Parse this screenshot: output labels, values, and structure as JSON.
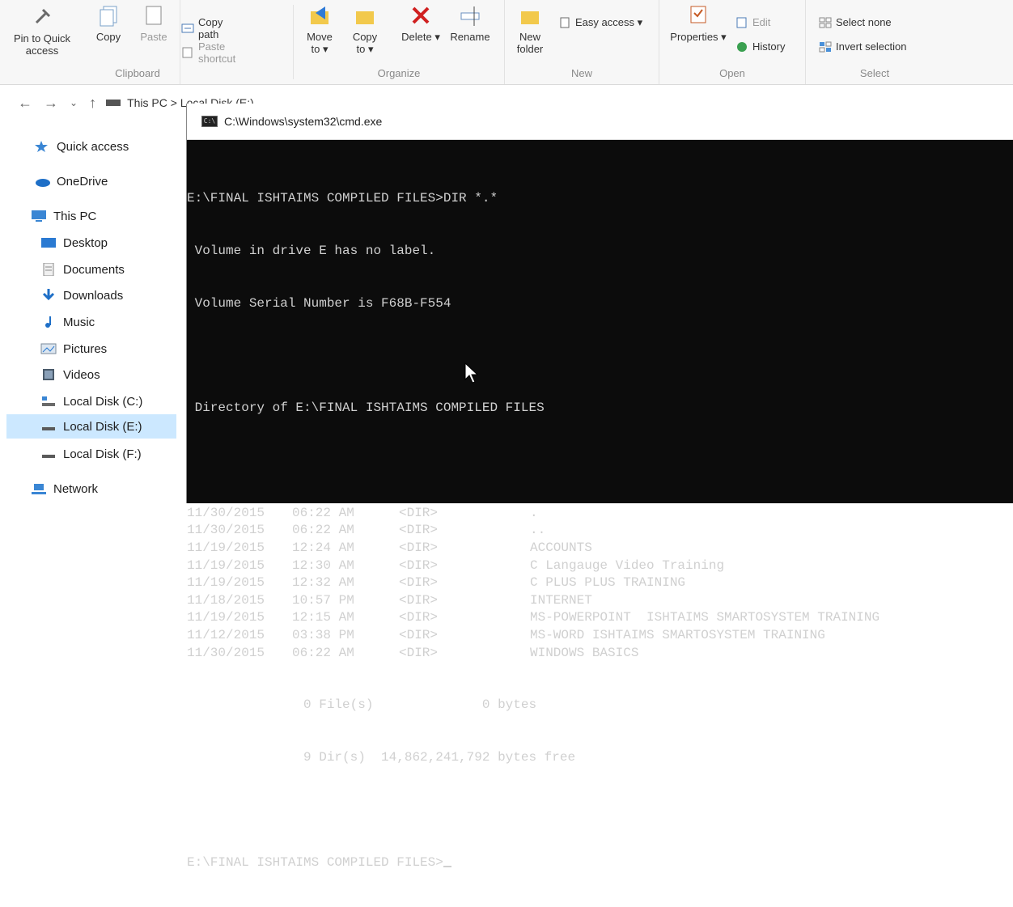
{
  "ribbon": {
    "clipboard": {
      "pin_label": "Pin to Quick access",
      "copy_label": "Copy",
      "paste_label": "Paste",
      "copy_path_label": "Copy path",
      "paste_shortcut_label": "Paste shortcut",
      "group_label": "Clipboard"
    },
    "organize": {
      "move_to_label": "Move to ▾",
      "copy_to_label": "Copy to ▾",
      "delete_label": "Delete ▾",
      "rename_label": "Rename",
      "group_label": "Organize"
    },
    "new": {
      "new_folder_label": "New folder",
      "easy_access_label": "Easy access ▾",
      "group_label": "New"
    },
    "open": {
      "properties_label": "Properties ▾",
      "edit_label": "Edit",
      "history_label": "History",
      "group_label": "Open"
    },
    "select": {
      "select_none_label": "Select none",
      "invert_selection_label": "Invert selection",
      "group_label": "Select"
    }
  },
  "address_bar": {
    "path": "This PC  >  Local Disk (E:)"
  },
  "nav_pane": {
    "items": [
      {
        "label": "Quick access"
      },
      {
        "label": "OneDrive"
      },
      {
        "label": "This PC"
      },
      {
        "label": "Desktop"
      },
      {
        "label": "Documents"
      },
      {
        "label": "Downloads"
      },
      {
        "label": "Music"
      },
      {
        "label": "Pictures"
      },
      {
        "label": "Videos"
      },
      {
        "label": "Local Disk (C:)"
      },
      {
        "label": "Local Disk (E:)"
      },
      {
        "label": "Local Disk (F:)"
      },
      {
        "label": "Network"
      }
    ]
  },
  "cmd": {
    "title": "C:\\Windows\\system32\\cmd.exe",
    "command_line": "E:\\FINAL ISHTAIMS COMPILED FILES>DIR *.*",
    "volume_label_line": " Volume in drive E has no label.",
    "serial_line": " Volume Serial Number is F68B-F554",
    "directory_line": " Directory of E:\\FINAL ISHTAIMS COMPILED FILES",
    "entries": [
      {
        "date": "11/30/2015",
        "time": "06:22 AM",
        "type": "<DIR>",
        "name": "."
      },
      {
        "date": "11/30/2015",
        "time": "06:22 AM",
        "type": "<DIR>",
        "name": ".."
      },
      {
        "date": "11/19/2015",
        "time": "12:24 AM",
        "type": "<DIR>",
        "name": "ACCOUNTS"
      },
      {
        "date": "11/19/2015",
        "time": "12:30 AM",
        "type": "<DIR>",
        "name": "C Langauge Video Training"
      },
      {
        "date": "11/19/2015",
        "time": "12:32 AM",
        "type": "<DIR>",
        "name": "C PLUS PLUS TRAINING"
      },
      {
        "date": "11/18/2015",
        "time": "10:57 PM",
        "type": "<DIR>",
        "name": "INTERNET"
      },
      {
        "date": "11/19/2015",
        "time": "12:15 AM",
        "type": "<DIR>",
        "name": "MS-POWERPOINT  ISHTAIMS SMARTOSYSTEM TRAINING"
      },
      {
        "date": "11/12/2015",
        "time": "03:38 PM",
        "type": "<DIR>",
        "name": "MS-WORD ISHTAIMS SMARTOSYSTEM TRAINING"
      },
      {
        "date": "11/30/2015",
        "time": "06:22 AM",
        "type": "<DIR>",
        "name": "WINDOWS BASICS"
      }
    ],
    "files_summary": "               0 File(s)              0 bytes",
    "dirs_summary": "               9 Dir(s)  14,862,241,792 bytes free",
    "prompt_line": "E:\\FINAL ISHTAIMS COMPILED FILES>"
  },
  "colors": {
    "console_bg": "#0c0c0c",
    "console_text": "#d0d0d0",
    "nav_selected": "#cce8ff",
    "ribbon_bg": "#f7f7f7"
  }
}
